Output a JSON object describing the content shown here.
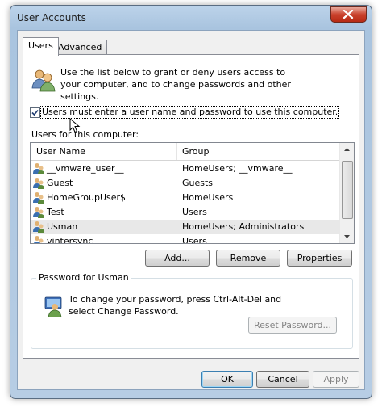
{
  "window": {
    "title": "User Accounts"
  },
  "tabs": [
    {
      "label": "Users",
      "active": true
    },
    {
      "label": "Advanced",
      "active": false
    }
  ],
  "intro_text": "Use the list below to grant or deny users access to your computer, and to change passwords and other settings.",
  "require_login": {
    "label": "Users must enter a user name and password to use this computer.",
    "checked": true
  },
  "users_label": "Users for this computer:",
  "list": {
    "columns": [
      "User Name",
      "Group"
    ],
    "rows": [
      {
        "name": "__vmware_user__",
        "group": "HomeUsers; __vmware__"
      },
      {
        "name": "Guest",
        "group": "Guests"
      },
      {
        "name": "HomeGroupUser$",
        "group": "HomeUsers"
      },
      {
        "name": "Test",
        "group": "Users"
      },
      {
        "name": "Usman",
        "group": "HomeUsers; Administrators"
      },
      {
        "name": "vintersync",
        "group": "Users"
      }
    ],
    "selected": "Usman"
  },
  "buttons": {
    "add": "Add...",
    "remove": "Remove",
    "properties": "Properties",
    "reset_password": "Reset Password...",
    "ok": "OK",
    "cancel": "Cancel",
    "apply": "Apply"
  },
  "password_group": {
    "title": "Password for Usman",
    "text": "To change your password, press Ctrl-Alt-Del and select Change Password."
  },
  "colors": {
    "accent_blue": "#3a6fb0",
    "selected_row": "#e8e8e8"
  }
}
